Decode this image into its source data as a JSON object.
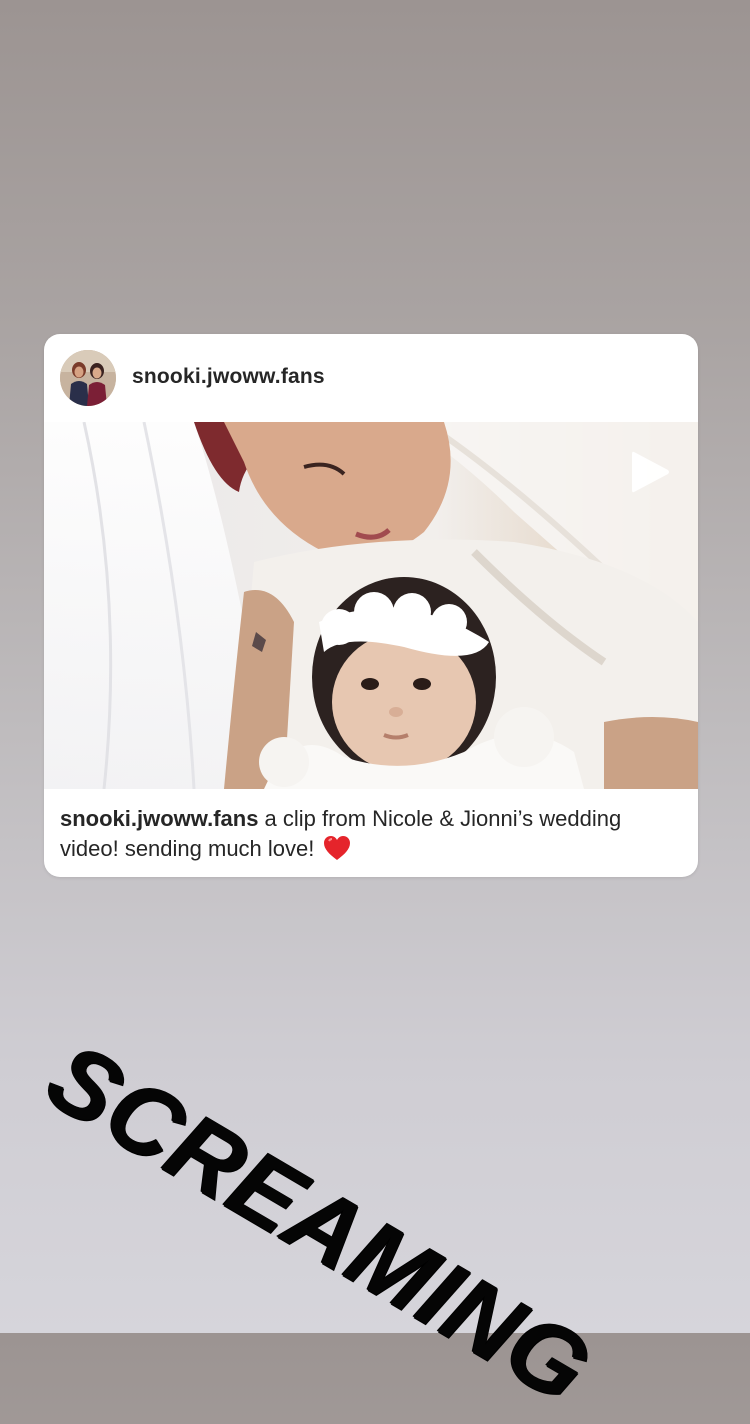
{
  "post": {
    "username": "snooki.jwoww.fans",
    "avatar_icon": "profile-photo",
    "caption_user": "snooki.jwoww.fans",
    "caption_text": " a clip from Nicole & Jionni’s wedding video! sending much love! ",
    "media_type": "video",
    "play_icon": "play-icon",
    "emoji": "red-heart-icon"
  },
  "sticker": {
    "text": "SCREAMING"
  },
  "colors": {
    "background_top": "#9c9492",
    "background_bottom": "#d6d5db",
    "card": "#ffffff",
    "text": "#262626",
    "heart": "#e5242b",
    "sticker": "#050505"
  }
}
